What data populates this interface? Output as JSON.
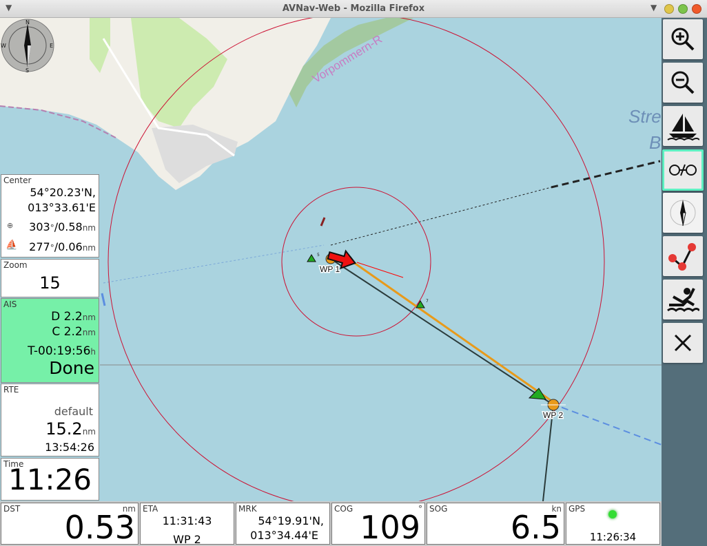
{
  "window": {
    "title": "AVNav-Web - Mozilla Firefox",
    "close_color": "#f05a2b",
    "max_color": "#7cc44b",
    "min_color": "#e0c64a"
  },
  "map": {
    "water_color": "#aad3df",
    "land_color": "#f1efe8",
    "coast_label": "Vorpommern-R",
    "sea_label_1": "Stre",
    "sea_label_2": "B",
    "wp1_label": "WP 1",
    "wp2_label": "WP 2",
    "compass_n": "N",
    "compass_s": "S",
    "compass_e": "E",
    "compass_w": "W",
    "mark_5": "5",
    "mark_7": "7"
  },
  "center": {
    "label": "Center",
    "lat": "54°20.23'N,",
    "lon": "013°33.61'E",
    "bearing1": "303",
    "dist1": "/0.58",
    "bearing2": "277",
    "dist2": "/0.06",
    "deg_unit": "°",
    "nm": "nm"
  },
  "zoom": {
    "label": "Zoom",
    "value": "15"
  },
  "ais": {
    "label": "AIS",
    "d_label": "D",
    "d_value": "2.2",
    "c_label": "C",
    "c_value": "2.2",
    "t_value": "T-00:19:56",
    "t_unit": "h",
    "status": "Done",
    "nm": "nm"
  },
  "rte": {
    "label": "RTE",
    "name": "default",
    "dist": "15.2",
    "nm": "nm",
    "eta": "13:54:26"
  },
  "time": {
    "label": "Time",
    "value": "11:26"
  },
  "bottom": {
    "dst": {
      "label": "DST",
      "unit": "nm",
      "value": "0.53"
    },
    "eta": {
      "label": "ETA",
      "value": "11:31:43",
      "wp": "WP 2"
    },
    "mrk": {
      "label": "MRK",
      "lat": "54°19.91'N,",
      "lon": "013°34.44'E"
    },
    "cog": {
      "label": "COG",
      "unit": "°",
      "value": "109"
    },
    "sog": {
      "label": "SOG",
      "unit": "kn",
      "value": "6.5"
    },
    "gps": {
      "label": "GPS",
      "time": "11:26:34",
      "status_color": "#33dd33"
    }
  },
  "toolbar": {
    "buttons": [
      "zoom-in",
      "zoom-out",
      "boat",
      "lock-course",
      "compass-north",
      "route",
      "man-overboard",
      "close"
    ]
  }
}
